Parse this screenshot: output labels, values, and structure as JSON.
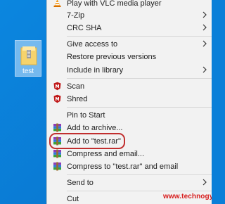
{
  "desktop": {
    "folder_name": "test",
    "background_color": "#0a7fd8"
  },
  "menu": {
    "items": [
      {
        "label": "Play with VLC media player",
        "icon": "vlc-icon"
      },
      {
        "label": "7-Zip",
        "icon": "",
        "submenu": true
      },
      {
        "label": "CRC SHA",
        "icon": "",
        "submenu": true
      },
      {
        "label": "Give access to",
        "icon": "",
        "submenu": true
      },
      {
        "label": "Restore previous versions",
        "icon": ""
      },
      {
        "label": "Include in library",
        "icon": "",
        "submenu": true
      },
      {
        "label": "Scan",
        "icon": "mcafee-icon"
      },
      {
        "label": "Shred",
        "icon": "mcafee-icon"
      },
      {
        "label": "Pin to Start",
        "icon": ""
      },
      {
        "label": "Add to archive...",
        "icon": "winrar-icon"
      },
      {
        "label": "Add to \"test.rar\"",
        "icon": "winrar-icon",
        "highlighted": true
      },
      {
        "label": "Compress and email...",
        "icon": "winrar-icon"
      },
      {
        "label": "Compress to \"test.rar\" and email",
        "icon": "winrar-icon"
      },
      {
        "label": "Send to",
        "icon": "",
        "submenu": true
      },
      {
        "label": "Cut",
        "icon": ""
      }
    ]
  },
  "watermark": "www.technogyan.in",
  "colors": {
    "menu_background": "#f2f2f2",
    "highlight_border": "#c12f2f",
    "watermark_color": "#d71d1d"
  }
}
